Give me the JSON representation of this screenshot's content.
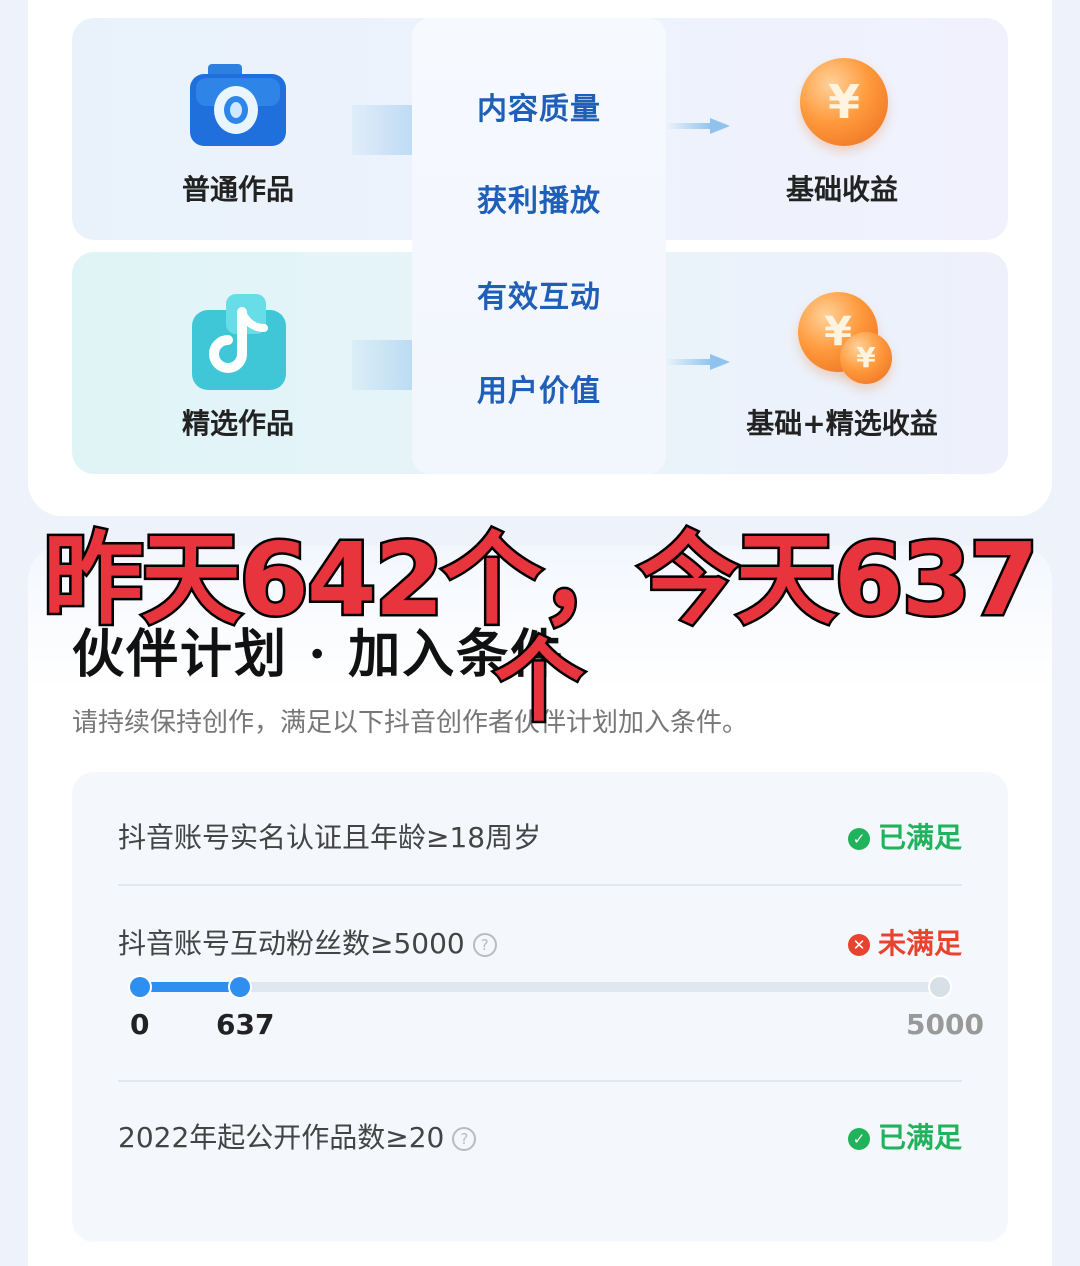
{
  "tiers": [
    {
      "work_label": "普通作品",
      "income_label": "基础收益",
      "icon": "camera-icon",
      "coin_glyph": "¥"
    },
    {
      "work_label": "精选作品",
      "income_label": "基础+精选收益",
      "icon": "douyin-logo-icon",
      "coin_glyph": "¥"
    }
  ],
  "metrics": [
    "内容质量",
    "获利播放",
    "有效互动",
    "用户价值"
  ],
  "overlay": {
    "line1": "昨天642个，今天637",
    "line2": "个"
  },
  "section": {
    "title": "伙伴计划 · 加入条件",
    "subtitle": "请持续保持创作，满足以下抖音创作者伙伴计划加入条件。"
  },
  "requirements": [
    {
      "text": "抖音账号实名认证且年龄≥18周岁",
      "status": "已满足",
      "met": true,
      "help": false
    },
    {
      "text": "抖音账号互动粉丝数≥5000",
      "status": "未满足",
      "met": false,
      "help": true
    },
    {
      "text": "2022年起公开作品数≥20",
      "status": "已满足",
      "met": true,
      "help": true
    }
  ],
  "progress": {
    "min": 0,
    "current": 637,
    "max": 5000,
    "min_label": "0",
    "current_label": "637",
    "max_label": "5000"
  },
  "colors": {
    "ok": "#21b35c",
    "bad": "#e8432f",
    "accent": "#2f8ff0",
    "metric": "#1f5fb8",
    "overlay": "#e8343c"
  }
}
